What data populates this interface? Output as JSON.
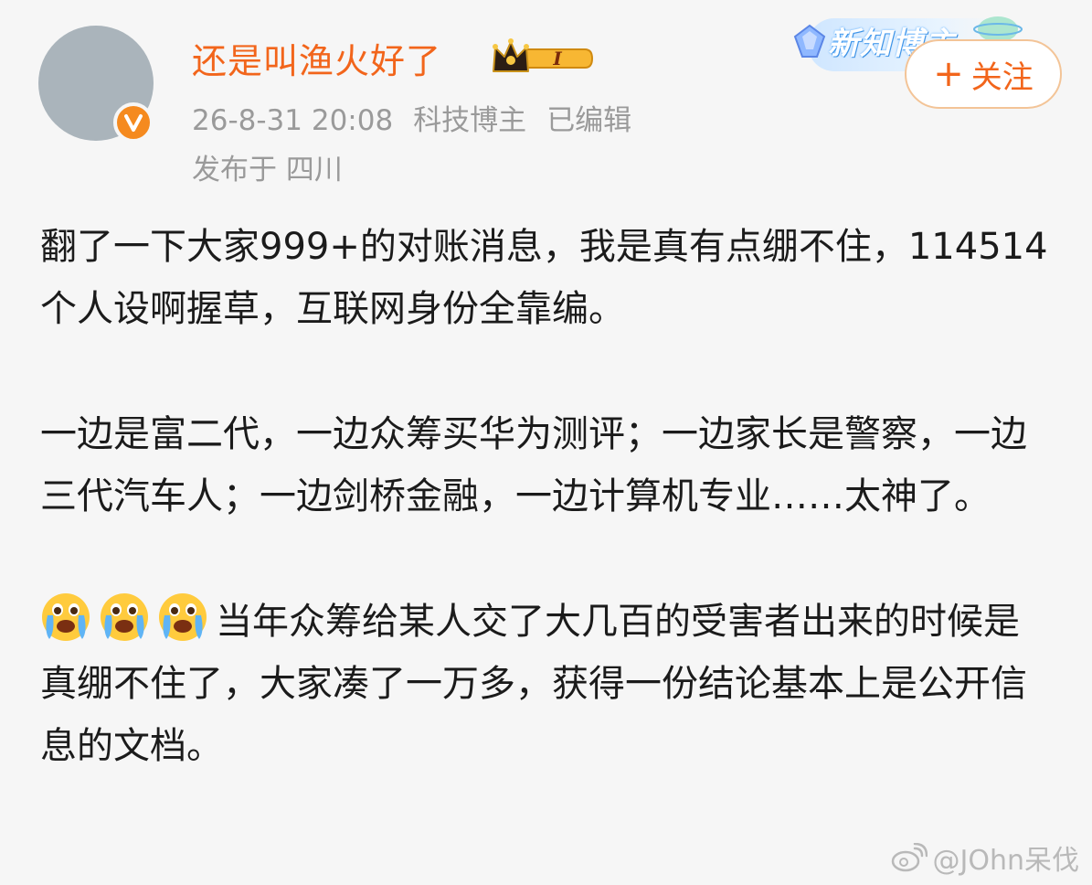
{
  "post": {
    "author": {
      "name": "还是叫渔火好了",
      "level_badge": "I",
      "verified_icon": "verified-v-icon",
      "avatar_icon": "avatar-placeholder"
    },
    "meta": {
      "timestamp": "26-8-31 20:08",
      "role": "科技博主",
      "edited": "已编辑",
      "location": "发布于 四川"
    },
    "badge": {
      "text": "新知博主"
    },
    "follow_button": {
      "plus": "+",
      "label": "关注"
    },
    "paragraphs": [
      "翻了一下大家999+的对账消息，我是真有点绷不住，114514个人设啊握草，互联网身份全靠编。",
      "一边是富二代，一边众筹买华为测评；一边家长是警察，一边三代汽车人；一边剑桥金融，一边计算机专业……太神了。",
      "当年众筹给某人交了大几百的受害者出来的时候是真绷不住了，大家凑了一万多，获得一份结论基本上是公开信息的文档。"
    ],
    "paragraph3_emojis": [
      "crying-face-emoji",
      "crying-face-emoji",
      "crying-face-emoji"
    ]
  },
  "watermark": {
    "text": "@JOhn呆伐",
    "icon": "weibo-logo-icon"
  },
  "colors": {
    "accent": "#f2651b",
    "meta_text": "#9a9a9a",
    "body_text": "#1b1b1b",
    "background": "#f6f6f6"
  }
}
